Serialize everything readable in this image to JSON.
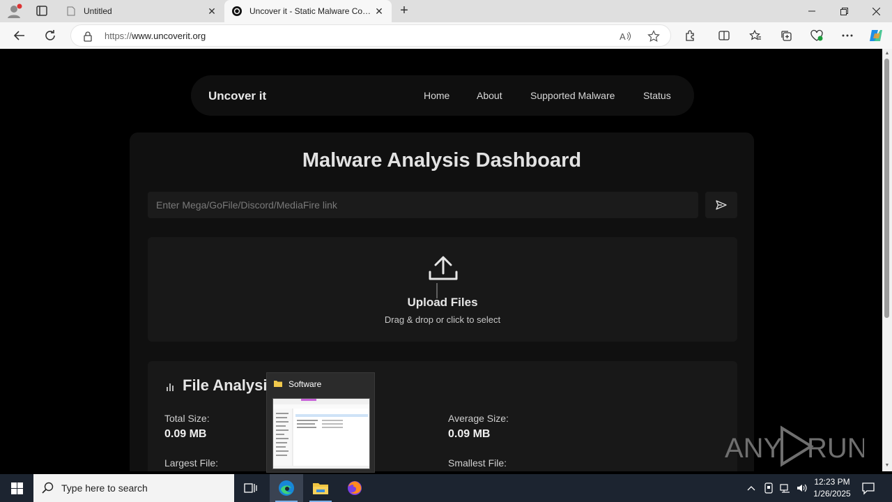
{
  "browser": {
    "tabs": [
      {
        "title": "Untitled",
        "active": false
      },
      {
        "title": "Uncover it - Static Malware Config Extractor",
        "active": true
      }
    ],
    "address": {
      "scheme": "https://",
      "host": "www.uncoverit.org"
    }
  },
  "site": {
    "brand": "Uncover it",
    "nav": [
      "Home",
      "About",
      "Supported Malware",
      "Status"
    ],
    "dashboard_title": "Malware Analysis Dashboard",
    "link_placeholder": "Enter Mega/GoFile/Discord/MediaFire link",
    "upload": {
      "title": "Upload Files",
      "subtitle": "Drag & drop or click to select"
    },
    "analysis": {
      "title": "File Analysis",
      "stats": [
        {
          "label": "Total Size:",
          "value": "0.09 MB"
        },
        {
          "label": "Average Size:",
          "value": "0.09 MB"
        },
        {
          "label": "Largest File:",
          "value": ""
        },
        {
          "label": "Smallest File:",
          "value": ""
        }
      ]
    },
    "watermark": "ANY RUN"
  },
  "thumbnail": {
    "title": "Software"
  },
  "taskbar": {
    "search_placeholder": "Type here to search",
    "time": "12:23 PM",
    "date": "1/26/2025"
  },
  "colors": {
    "accent": "#0a7cd6",
    "page_bg": "#000000",
    "card_bg": "#101010"
  }
}
